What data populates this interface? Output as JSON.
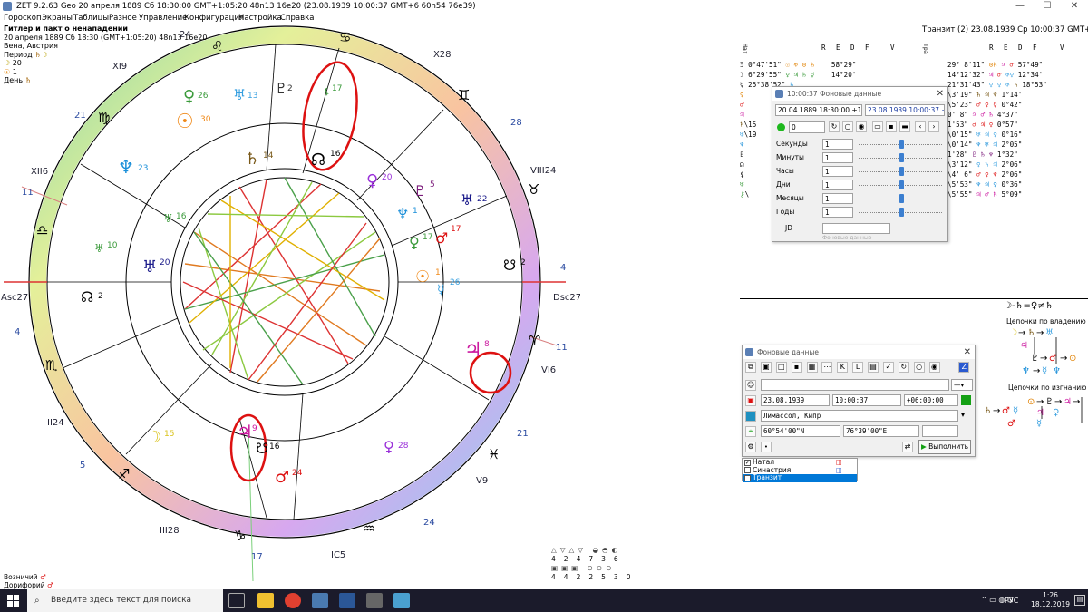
{
  "window": {
    "title": "ZET 9.2.63 Geo  20 апреля 1889  Сб  18:30:00 GMT+1:05:20 48n13  16e20  (23.08.1939  10:00:37 GMT+6 60n54 76e39)",
    "minimize": "—",
    "maximize": "☐",
    "close": "✕"
  },
  "menu": [
    "Гороскоп",
    "Экраны",
    "Таблицы",
    "Разное",
    "Управление",
    "Конфигурация",
    "Настройка",
    "Справка"
  ],
  "chart_info": {
    "title": "Гитлер и пакт о ненападении",
    "line1": "20 апреля 1889  Сб  18:30 (GMT+1:05:20) 48n13  16e20",
    "line2": "Вена, Австрия",
    "period_label": "Период",
    "period_val1": "20",
    "period_val2": "1",
    "day_label": "День"
  },
  "transit_title": "Транзит (2) 23.08.1939  Ср 10:00:37 GMT+6",
  "natal_table": {
    "head_nat": "Нат",
    "cols": [
      "R",
      "E",
      "D",
      "F",
      "V"
    ],
    "rows": [
      {
        "p": "Э",
        "pos": "0°47'51\"",
        "v": "58°29\""
      },
      {
        "p": "☽",
        "pos": "6°29'55\"",
        "v": "14°20'"
      },
      {
        "p": "☿",
        "pos": "25°38'52\"",
        "v": ""
      },
      {
        "p": "♀",
        "pos": "",
        "v": ""
      },
      {
        "p": "♂",
        "pos": "",
        "v": ""
      },
      {
        "p": "♃",
        "pos": "",
        "v": ""
      },
      {
        "p": "♄",
        "pos": "\\15",
        "v": ""
      },
      {
        "p": "♅",
        "pos": "\\19",
        "v": ""
      },
      {
        "p": "♆",
        "pos": "",
        "v": ""
      },
      {
        "p": "♇",
        "pos": "",
        "v": ""
      },
      {
        "p": "☊",
        "pos": "",
        "v": ""
      },
      {
        "p": "⚸",
        "pos": "",
        "v": ""
      },
      {
        "p": "♅",
        "pos": "",
        "v": ""
      },
      {
        "p": "⚷",
        "pos": "\\",
        "v": ""
      }
    ]
  },
  "transit_table": {
    "head_tra": "Тра",
    "cols": [
      "R",
      "E",
      "D",
      "F",
      "V"
    ],
    "rows": [
      {
        "pos": "29° 8'11\"",
        "v": "57°49\""
      },
      {
        "pos": "14°12'32\"",
        "v": "12°34'"
      },
      {
        "pos": "21°31'43\"",
        "v": "18°53\""
      },
      {
        "pos": "\\3'19\"",
        "v": "1°14'"
      },
      {
        "pos": "\\5'23\"",
        "v": "0°42\""
      },
      {
        "pos": "0' 8\"",
        "v": "4°37\""
      },
      {
        "pos": "1'53\"",
        "v": "0°57\""
      },
      {
        "pos": "\\0'15\"",
        "v": "0°16\""
      },
      {
        "pos": "\\0'14\"",
        "v": "2°05\""
      },
      {
        "pos": "1'28\"",
        "v": "1°32\""
      },
      {
        "pos": "\\3'12\"",
        "v": "2°06\""
      },
      {
        "pos": "\\4' 6\"",
        "v": "2°06\""
      },
      {
        "pos": "\\5'53\"",
        "v": "0°36\""
      },
      {
        "pos": "\\5'55\"",
        "v": "5°09\""
      }
    ]
  },
  "time_window": {
    "title": "10:00:37 Фоновые данные",
    "date_natal": "20.04.1889  18:30:00  +1:05:20",
    "date_transit": "23.08.1939  10:00:37  +6",
    "counter": "0",
    "rows": [
      {
        "label": "Секунды",
        "val": "1"
      },
      {
        "label": "Минуты",
        "val": "1"
      },
      {
        "label": "Часы",
        "val": "1"
      },
      {
        "label": "Дни",
        "val": "1"
      },
      {
        "label": "Месяцы",
        "val": "1"
      },
      {
        "label": "Годы",
        "val": "1"
      }
    ],
    "jd_label": "JD",
    "faded": "Фоновые данные"
  },
  "bg_window": {
    "title": "Фоновые данные",
    "date": "23.08.1939",
    "time": "10:00:37",
    "tz": "+06:00:00",
    "place": "Лимассол, Кипр",
    "lat": "60°54'00\"N",
    "lon": "76°39'00\"E",
    "run_label": "Выполнить",
    "list": [
      {
        "label": "Натал",
        "checked": true
      },
      {
        "label": "Синастрия",
        "checked": false
      },
      {
        "label": "Транзит",
        "checked": true
      }
    ]
  },
  "chains": {
    "top": "☽-♄=♀≠♄",
    "label1": "Цепочки по владению",
    "label2": "Цепочки по изгнанию"
  },
  "bottom_left": {
    "line1": "Возничий",
    "line2": "Дорифорий"
  },
  "bottom_stats": {
    "row1": [
      "4",
      "2",
      "4",
      "7",
      "3",
      "6"
    ],
    "row2": [
      "4",
      "4",
      "2",
      "2",
      "5",
      "3",
      "0"
    ]
  },
  "wheel_labels": {
    "asc": "Asc27",
    "dsc": "Dsc27",
    "ic": "IC5",
    "top_num": "24",
    "house_nums": [
      "IX28",
      "VIII24",
      "VI6",
      "V9",
      "III28",
      "II24",
      "XII6",
      "XI9",
      "XI"
    ],
    "degs": [
      "11",
      "27",
      "4",
      "21",
      "5",
      "21",
      "24",
      "17",
      "11",
      "4",
      "28"
    ],
    "planets": [
      {
        "g": "♀",
        "n": "26"
      },
      {
        "g": "♅",
        "n": "13"
      },
      {
        "g": "♇",
        "n": "2"
      },
      {
        "g": "☉",
        "n": "30"
      },
      {
        "g": "♆",
        "n": "23"
      },
      {
        "g": "♄",
        "n": "14"
      },
      {
        "g": "☊",
        "n": "16"
      },
      {
        "g": "♀",
        "n": "20"
      },
      {
        "g": "♇",
        "n": "5"
      },
      {
        "g": "♅",
        "n": "22"
      },
      {
        "g": "♆",
        "n": "1"
      },
      {
        "g": "♂",
        "n": "17"
      },
      {
        "g": "♀",
        "n": "17"
      },
      {
        "g": "♅",
        "n": "20"
      },
      {
        "g": "☉",
        "n": "1"
      },
      {
        "g": "☋",
        "n": "2"
      },
      {
        "g": "☿",
        "n": "26"
      },
      {
        "g": "♃",
        "n": "8"
      },
      {
        "g": "☽",
        "n": "15"
      },
      {
        "g": "♃",
        "n": "9"
      },
      {
        "g": "☋",
        "n": "16"
      },
      {
        "g": "♀",
        "n": "28"
      },
      {
        "g": "♂",
        "n": "24"
      },
      {
        "g": "☊",
        "n": "2"
      },
      {
        "g": "⚸",
        "n": "17"
      },
      {
        "g": "♅",
        "n": "16"
      },
      {
        "g": "♅",
        "n": "10"
      }
    ]
  },
  "taskbar": {
    "search_placeholder": "Введите здесь текст для поиска",
    "lang": "РУС",
    "time": "1:26",
    "date": "18.12.2019"
  }
}
